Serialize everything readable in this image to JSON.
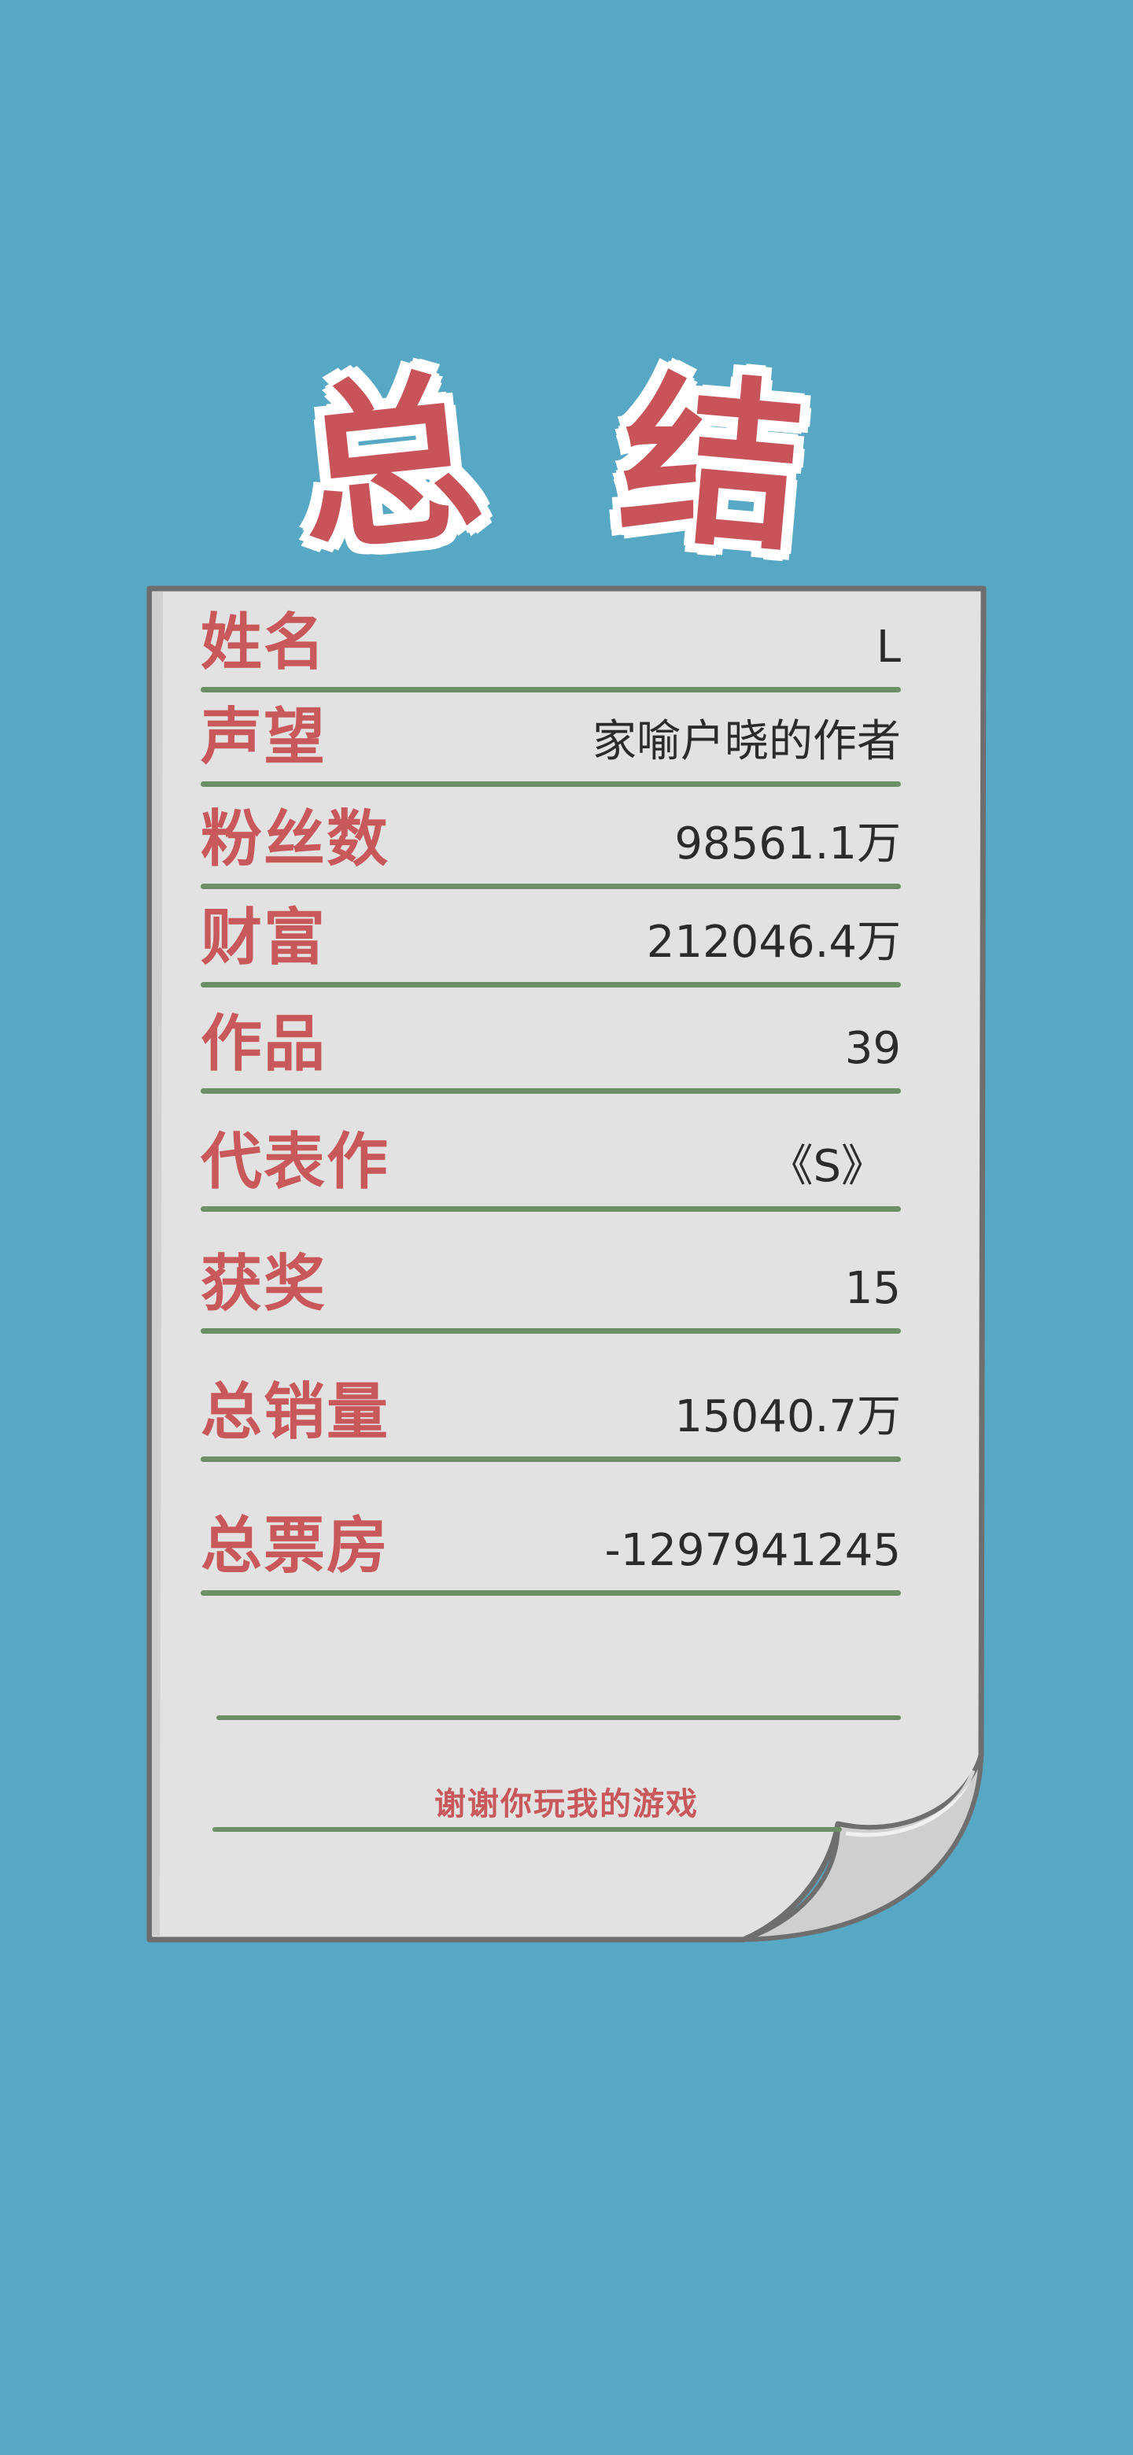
{
  "title": {
    "char1": "总",
    "char2": "结"
  },
  "stats": [
    {
      "label": "姓名",
      "value": "L"
    },
    {
      "label": "声望",
      "value": "家喻户晓的作者"
    },
    {
      "label": "粉丝数",
      "value": "98561.1万"
    },
    {
      "label": "财富",
      "value": "212046.4万"
    },
    {
      "label": "作品",
      "value": "39"
    },
    {
      "label": "代表作",
      "value": "《S》"
    },
    {
      "label": "获奖",
      "value": "15"
    },
    {
      "label": "总销量",
      "value": "15040.7万"
    },
    {
      "label": "总票房",
      "value": "-1297941245"
    }
  ],
  "footer": {
    "thanks": "谢谢你玩我的游戏"
  },
  "colors": {
    "background": "#57a8c5",
    "paper": "#e2e2e2",
    "label": "#c9585b",
    "rule": "#6d8f66",
    "value": "#2b2b2b"
  }
}
